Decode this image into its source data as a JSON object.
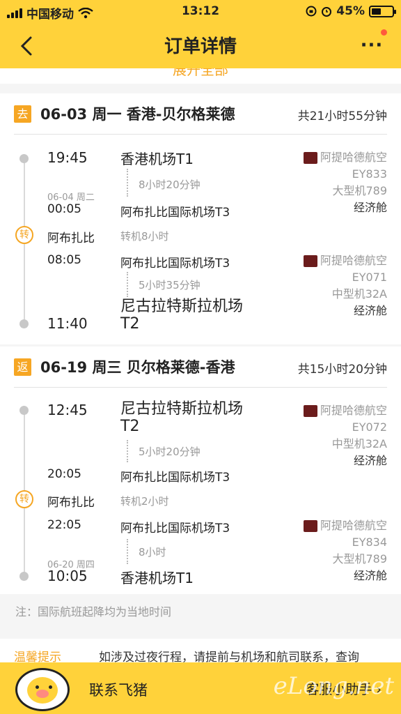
{
  "status_bar": {
    "carrier": "中国移动",
    "time": "13:12",
    "battery_percent": "45%",
    "battery_level": 0.45
  },
  "nav": {
    "title": "订单详情",
    "more": "···"
  },
  "expand_label": "展开全部",
  "outbound": {
    "tag": "去",
    "route": "06-03 周一 香港-贝尔格莱德",
    "total": "共21小时55分钟",
    "seg1": {
      "dep_time": "19:45",
      "dep_airport": "香港机场T1",
      "duration": "8小时20分钟",
      "arr_date": "06-04 周二",
      "arr_time": "00:05",
      "arr_airport": "阿布扎比国际机场T3",
      "airline": "阿提哈德航空",
      "flight_no": "EY833",
      "aircraft": "大型机789",
      "cabin": "经济舱"
    },
    "transfer": {
      "badge": "转",
      "city": "阿布扎比",
      "layover": "转机8小时"
    },
    "seg2": {
      "dep_time": "08:05",
      "dep_airport": "阿布扎比国际机场T3",
      "duration": "5小时35分钟",
      "arr_time": "11:40",
      "arr_airport": "尼古拉特斯拉机场T2",
      "airline": "阿提哈德航空",
      "flight_no": "EY071",
      "aircraft": "中型机32A",
      "cabin": "经济舱"
    }
  },
  "return": {
    "tag": "返",
    "route": "06-19 周三 贝尔格莱德-香港",
    "total": "共15小时20分钟",
    "seg1": {
      "dep_time": "12:45",
      "dep_airport": "尼古拉特斯拉机场T2",
      "duration": "5小时20分钟",
      "arr_time": "20:05",
      "arr_airport": "阿布扎比国际机场T3",
      "airline": "阿提哈德航空",
      "flight_no": "EY072",
      "aircraft": "中型机32A",
      "cabin": "经济舱"
    },
    "transfer": {
      "badge": "转",
      "city": "阿布扎比",
      "layover": "转机2小时"
    },
    "seg2": {
      "dep_time": "22:05",
      "dep_airport": "阿布扎比国际机场T3",
      "duration": "8小时",
      "arr_date": "06-20 周四",
      "arr_time": "10:05",
      "arr_airport": "香港机场T1",
      "airline": "阿提哈德航空",
      "flight_no": "EY834",
      "aircraft": "大型机789",
      "cabin": "经济舱"
    }
  },
  "note": "注：国际航班起降均为当地时间",
  "tips": {
    "label": "温馨提示",
    "text": "如涉及过夜行程，请提前与机场和航司联系，查询"
  },
  "bottom": {
    "contact": "联系飞猪",
    "assistant": "客服小助手 ›",
    "watermark": "eLong.net"
  },
  "colors": {
    "brand_yellow": "#ffd23a",
    "accent_orange": "#f5a623",
    "badge_dot": "#ff5a3c"
  }
}
